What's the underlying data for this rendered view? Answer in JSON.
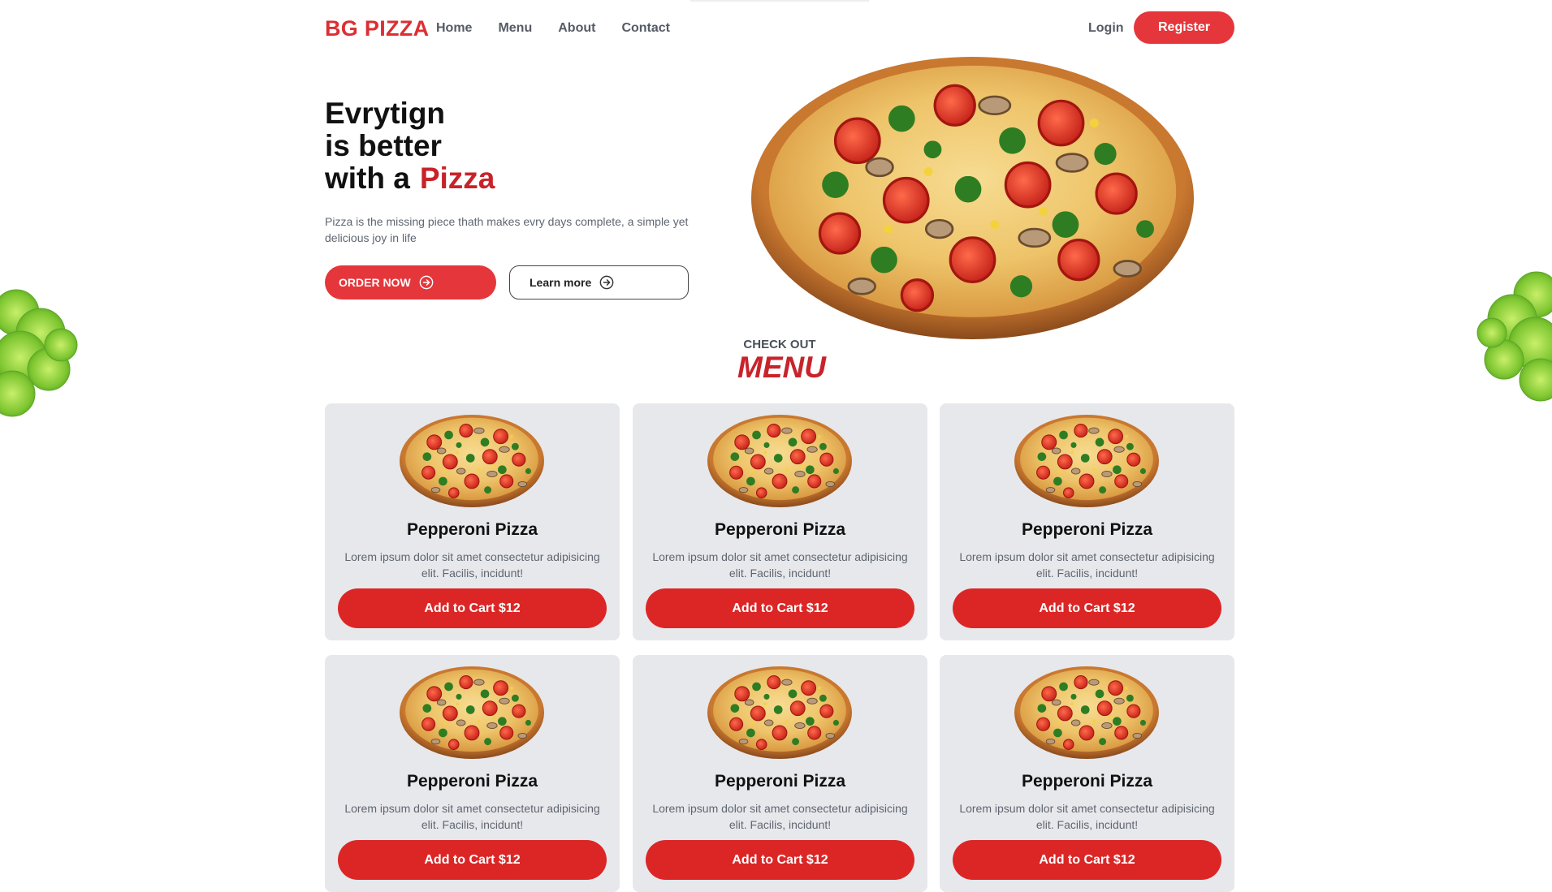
{
  "nav": {
    "brand": "BG PIZZA",
    "links": [
      "Home",
      "Menu",
      "About",
      "Contact"
    ],
    "login": "Login",
    "register": "Register"
  },
  "hero": {
    "title_line1": "Evrytign",
    "title_line2": "is better",
    "title_line3": "with a",
    "title_accent": "Pizza",
    "description": "Pizza is the missing piece thath makes evry days complete, a simple yet delicious joy in life",
    "order_button": "ORDER NOW",
    "learn_button": "Learn more"
  },
  "menu": {
    "eyebrow": "CHECK OUT",
    "title": "MENU",
    "items": [
      {
        "name": "Pepperoni Pizza",
        "desc": "Lorem ipsum dolor sit amet consectetur adipisicing elit. Facilis, incidunt!",
        "button": "Add to Cart $12"
      },
      {
        "name": "Pepperoni Pizza",
        "desc": "Lorem ipsum dolor sit amet consectetur adipisicing elit. Facilis, incidunt!",
        "button": "Add to Cart $12"
      },
      {
        "name": "Pepperoni Pizza",
        "desc": "Lorem ipsum dolor sit amet consectetur adipisicing elit. Facilis, incidunt!",
        "button": "Add to Cart $12"
      },
      {
        "name": "Pepperoni Pizza",
        "desc": "Lorem ipsum dolor sit amet consectetur adipisicing elit. Facilis, incidunt!",
        "button": "Add to Cart $12"
      },
      {
        "name": "Pepperoni Pizza",
        "desc": "Lorem ipsum dolor sit amet consectetur adipisicing elit. Facilis, incidunt!",
        "button": "Add to Cart $12"
      },
      {
        "name": "Pepperoni Pizza",
        "desc": "Lorem ipsum dolor sit amet consectetur adipisicing elit. Facilis, incidunt!",
        "button": "Add to Cart $12"
      }
    ]
  },
  "colors": {
    "brand_red": "#dc2f34",
    "accent_red": "#c8232a",
    "button_red": "#dc2626",
    "card_bg": "#e7e8ec",
    "text_gray": "#5f6670"
  },
  "icons": [
    "arrow-circle-right-icon",
    "pizza-image",
    "lettuce-decoration"
  ]
}
